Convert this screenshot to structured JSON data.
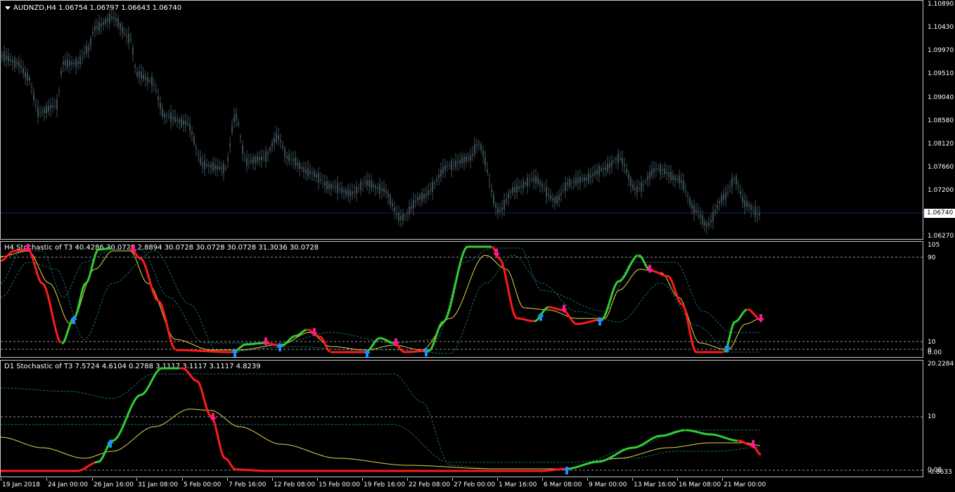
{
  "main": {
    "symbol_line": "AUDNZD,H4  1.06754 1.06797 1.06643 1.06740",
    "price_labels": [
      "1.10890",
      "1.10430",
      "1.09970",
      "1.09510",
      "1.09040",
      "1.08580",
      "1.08120",
      "1.07660",
      "1.07200",
      "1.06270"
    ],
    "current_price": "1.06740",
    "colors": {
      "candle": "#3a4e56",
      "bid_line": "#12246e"
    }
  },
  "h4": {
    "title": "H4    Stochastic of T3 40.4286 30.0728 2.8894 30.0728 30.0728 30.0728 31.3036 30.0728",
    "labels": [
      "105",
      "90",
      "10",
      "0",
      "0.00"
    ]
  },
  "d1": {
    "title": "D1    Stochastic of T3 7.5724 4.6104 0.2788 3.1117 3.1117 3.1117 4.8239",
    "labels": [
      "20.2284",
      "10",
      "0.08",
      "-0.8633"
    ]
  },
  "time_axis": [
    "19 Jan 2018",
    "24 Jan 00:00",
    "26 Jan 16:00",
    "31 Jan 08:00",
    "5 Feb 00:00",
    "7 Feb 16:00",
    "12 Feb 08:00",
    "15 Feb 00:00",
    "19 Feb 16:00",
    "22 Feb 08:00",
    "27 Feb 00:00",
    "1 Mar 16:00",
    "6 Mar 08:00",
    "9 Mar 00:00",
    "13 Mar 16:00",
    "16 Mar 08:00",
    "21 Mar 00:00"
  ],
  "indicator_colors": {
    "up": "#33cc33",
    "down": "#ff1a1a",
    "signal": "#e8d44d",
    "bands": "#1c6b74",
    "up_arrow": "#1e90ff",
    "down_arrow": "#ff1a8c",
    "level": "#c8c8c8"
  }
}
